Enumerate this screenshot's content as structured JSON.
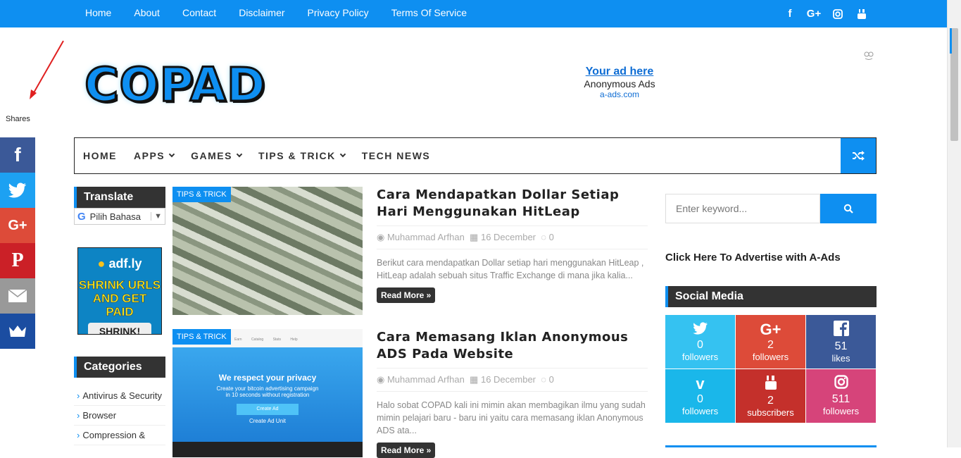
{
  "top_nav": {
    "links": [
      "Home",
      "About",
      "Contact",
      "Disclaimer",
      "Privacy Policy",
      "Terms Of Service"
    ],
    "social_icons": [
      "facebook-icon",
      "google-plus-icon",
      "instagram-icon",
      "youtube-icon"
    ]
  },
  "share_bar": {
    "label": "Shares",
    "buttons": [
      {
        "name": "facebook",
        "glyph": "f",
        "color": "#3b5998"
      },
      {
        "name": "twitter",
        "glyph": "t",
        "color": "#1da1f2"
      },
      {
        "name": "google-plus",
        "glyph": "G+",
        "color": "#dd4b39"
      },
      {
        "name": "pinterest",
        "glyph": "P",
        "color": "#cb2027"
      },
      {
        "name": "email",
        "glyph": "✉",
        "color": "#999999"
      },
      {
        "name": "sumo",
        "glyph": "♛",
        "color": "#1b4da1"
      }
    ]
  },
  "header": {
    "logo_text": "COPAD",
    "ad": {
      "title": "Your ad here",
      "line": "Anonymous Ads",
      "domain": "a-ads.com"
    }
  },
  "main_nav": {
    "items": [
      {
        "label": "HOME",
        "dropdown": false
      },
      {
        "label": "APPS",
        "dropdown": true
      },
      {
        "label": "GAMES",
        "dropdown": true
      },
      {
        "label": "TIPS & TRICK",
        "dropdown": true
      },
      {
        "label": "TECH NEWS",
        "dropdown": false
      }
    ]
  },
  "left_sidebar": {
    "translate_title": "Translate",
    "translate_select": "Pilih Bahasa",
    "adfly_banner": {
      "brand": "adf.ly",
      "headline_1": "SHRINK URLS",
      "headline_2": "AND GET PAID",
      "button": "SHRINK!"
    },
    "categories_title": "Categories",
    "categories": [
      "Antivirus & Security",
      "Browser",
      "Compression &"
    ]
  },
  "posts": [
    {
      "badge": "TIPS & TRICK",
      "title": "Cara Mendapatkan Dollar Setiap Hari Menggunakan HitLeap",
      "author": "Muhammad Arfhan",
      "date": "16 December",
      "comments": "0",
      "excerpt": "Berikut cara mendapatkan  Dollar  setiap hari menggunakan HitLeap , HitLeap  adalah sebuah situs  Traffic Exchange  di mana jika kalia...",
      "read_more": "Read More »"
    },
    {
      "badge": "TIPS & TRICK",
      "title": "Cara Memasang Iklan Anonymous ADS Pada Website",
      "author": "Muhammad Arfhan",
      "date": "16 December",
      "comments": "0",
      "excerpt": "Halo sobat COPAD kali ini mimin akan membagikan ilmu yang sudah mimin pelajari baru - baru ini yaitu cara memasang iklan Anonymous ADS ata...",
      "read_more": "Read More »",
      "thumb_text": {
        "heading": "We respect your privacy",
        "sub_1": "Create your bitcoin advertising campaign",
        "sub_2": "in 10 seconds without registration",
        "button": "Create Ad",
        "link": "Create Ad Unit",
        "nav": "Earn Catalog Stats Help"
      }
    }
  ],
  "right_sidebar": {
    "search_placeholder": "Enter keyword...",
    "advertise_link": "Click Here To Advertise with A-Ads",
    "social_title": "Social Media",
    "social": [
      {
        "icon": "twitter-icon",
        "glyph": "t",
        "count": "0",
        "label": "followers",
        "color": "#35c2f1"
      },
      {
        "icon": "google-plus-icon",
        "glyph": "G+",
        "count": "2",
        "label": "followers",
        "color": "#dd4b39"
      },
      {
        "icon": "facebook-icon",
        "glyph": "f",
        "count": "51",
        "label": "likes",
        "color": "#3b5998"
      },
      {
        "icon": "vimeo-icon",
        "glyph": "v",
        "count": "0",
        "label": "followers",
        "color": "#1ab7ea"
      },
      {
        "icon": "youtube-icon",
        "glyph": "▶",
        "count": "2",
        "label": "subscribers",
        "color": "#c4302b"
      },
      {
        "icon": "instagram-icon",
        "glyph": "◎",
        "count": "511",
        "label": "followers",
        "color": "#d6447a"
      }
    ]
  }
}
